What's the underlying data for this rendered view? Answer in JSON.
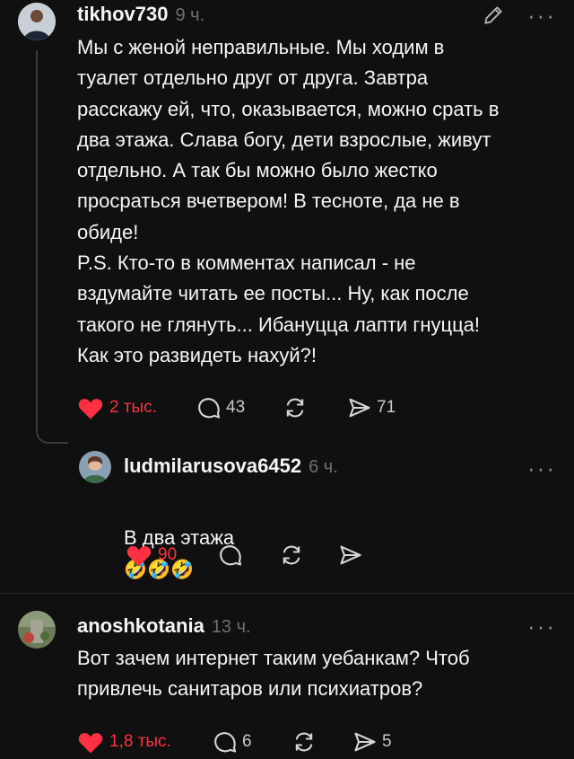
{
  "colors": {
    "background": "#101010",
    "text": "#f3f5f7",
    "muted": "#6f6f6f",
    "like": "#ff3040"
  },
  "post": {
    "username": "tikhov730",
    "time": "9 ч.",
    "text": "Мы с женой неправильные. Мы ходим в\nтуалет отдельно друг от друга. Завтра\nрасскажу ей, что, оказывается, можно срать в\nдва этажа. Слава богу, дети взрослые, живут\nотдельно. А так бы можно было жестко\nпросраться вчетвером! В тесноте, да не в\nобиде!\nP.S. Кто-то в комментах написал - не\nвздумайте читать ее посты... Ну, как после\nтакого не глянуть... Ибануцца лапти гнуцца!\nКак это развидеть нахуй?!",
    "likes": "2 тыс.",
    "comments": "43",
    "reposts": "",
    "shares": "71",
    "edit_icon": "pencil-icon",
    "more_icon": "more-icon"
  },
  "reply": {
    "username": "ludmilarusova6452",
    "time": "6 ч.",
    "text": "В два этажа",
    "emoji": "🤣🤣🤣",
    "likes": "90"
  },
  "comment2": {
    "username": "anoshkotania",
    "time": "13 ч.",
    "text": "Вот зачем интернет таким уебанкам? Чтоб\nпривлечь санитаров или психиатров?",
    "likes": "1,8 тыс.",
    "comments": "6",
    "shares": "5"
  }
}
